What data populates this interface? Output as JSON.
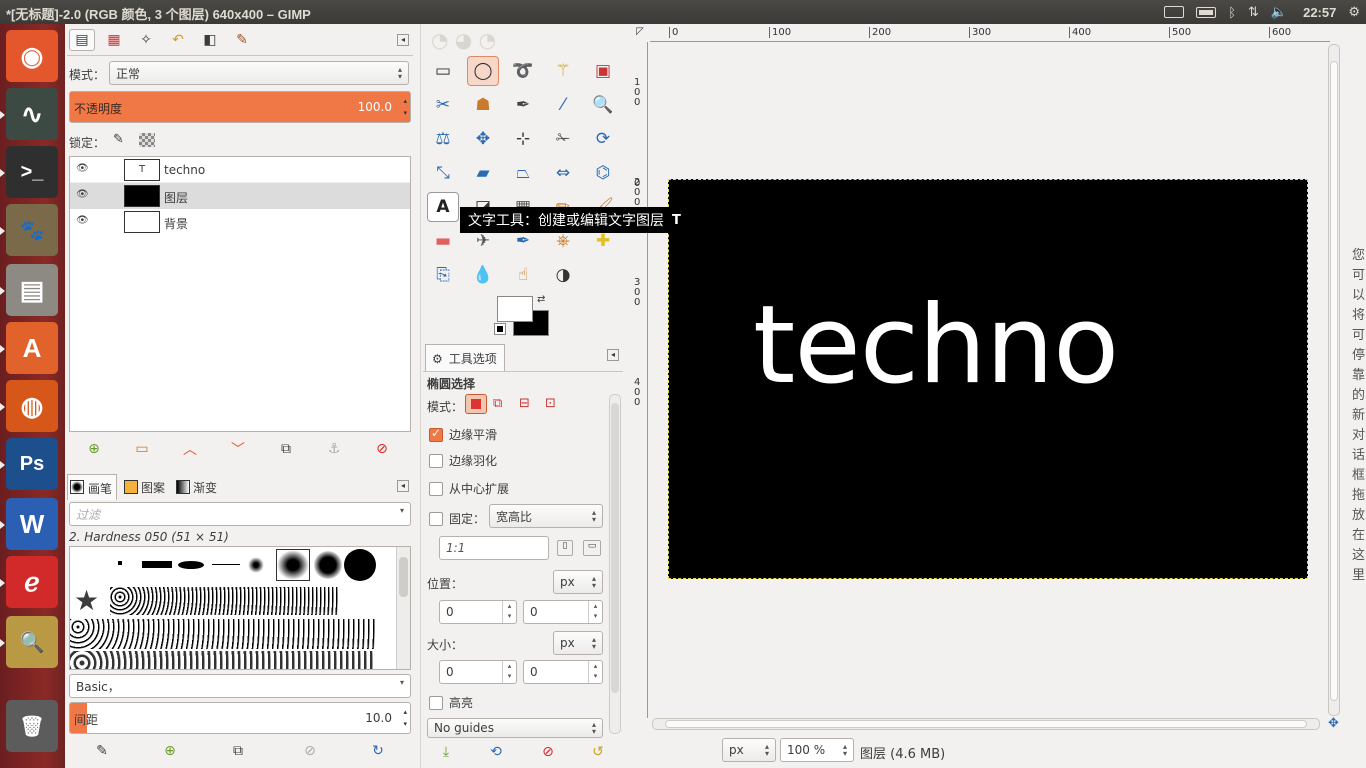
{
  "window": {
    "title": "*[无标题]-2.0 (RGB 颜色, 3 个图层) 640x400 – GIMP"
  },
  "tray": {
    "time": "22:57",
    "keyboard_icon": "keyboard-icon",
    "battery_icon": "battery-icon",
    "bluetooth_icon": "bluetooth-icon",
    "network_icon": "network-icon",
    "volume_icon": "volume-icon"
  },
  "launcher": {
    "items": [
      {
        "name": "ubuntu-dash",
        "glyph": "◉",
        "color": "#e4562b"
      },
      {
        "name": "system-monitor",
        "glyph": "∿",
        "color": "#3d4a44"
      },
      {
        "name": "terminal",
        "glyph": ">_",
        "color": "#2f2f2f"
      },
      {
        "name": "gimp",
        "glyph": "🐾",
        "color": "#7a6a4a"
      },
      {
        "name": "file-manager",
        "glyph": "▤",
        "color": "#8d8a84"
      },
      {
        "name": "software-center",
        "glyph": "A",
        "color": "#e2622b"
      },
      {
        "name": "firefox",
        "glyph": "◍",
        "color": "#d7571b"
      },
      {
        "name": "photoshop",
        "glyph": "Ps",
        "color": "#1c4f8c"
      },
      {
        "name": "wps-writer",
        "glyph": "W",
        "color": "#2a5fb3"
      },
      {
        "name": "pdf-reader",
        "glyph": "ℯ",
        "color": "#d22a2a"
      },
      {
        "name": "image-viewer",
        "glyph": "🔍",
        "color": "#b99944"
      },
      {
        "name": "trash",
        "glyph": "🗑",
        "color": "#5c5c5c"
      }
    ]
  },
  "layers_panel": {
    "mode_label": "模式：",
    "mode_value": "正常",
    "opacity_label": "不透明度",
    "opacity_value": "100.0",
    "lock_label": "锁定：",
    "layers": [
      {
        "name": "techno",
        "visible": true,
        "thumb": "text"
      },
      {
        "name": "图层",
        "visible": true,
        "thumb": "black"
      },
      {
        "name": "背景",
        "visible": true,
        "thumb": "white"
      }
    ]
  },
  "brushes_panel": {
    "tabs": [
      "画笔",
      "图案",
      "渐变"
    ],
    "filter_placeholder": "过滤",
    "brush_name": "2. Hardness 050 (51 × 51)",
    "tag_value": "Basic，",
    "spacing_label": "间距",
    "spacing_value": "10.0",
    "spacing_fraction": 0.1
  },
  "toolbox": {
    "tooltip": "文字工具：创建或编辑文字图层",
    "tooltip_key": "T"
  },
  "tool_options": {
    "tab_label": "工具选项",
    "tool_name": "椭圆选择",
    "mode_label": "模式：",
    "antialias_label": "边缘平滑",
    "antialias_checked": true,
    "feather_label": "边缘羽化",
    "expand_label": "从中心扩展",
    "fixed_label": "固定：",
    "fixed_value": "宽高比",
    "ratio_value": "1:1",
    "position_label": "位置：",
    "position_unit": "px",
    "position_x": "0",
    "position_y": "0",
    "size_label": "大小：",
    "size_unit": "px",
    "size_w": "0",
    "size_h": "0",
    "highlight_label": "高亮",
    "guides_value": "No guides"
  },
  "canvas": {
    "text": "techno",
    "unit": "px",
    "zoom": "100 %",
    "status": "图层 (4.6 MB)",
    "ruler_h": [
      "0",
      "100",
      "200",
      "300",
      "400",
      "500",
      "600"
    ],
    "ruler_v": [
      "100",
      "200",
      "300",
      "400"
    ],
    "side_hint": "您可以将可停靠的新对话框拖放在这里"
  }
}
